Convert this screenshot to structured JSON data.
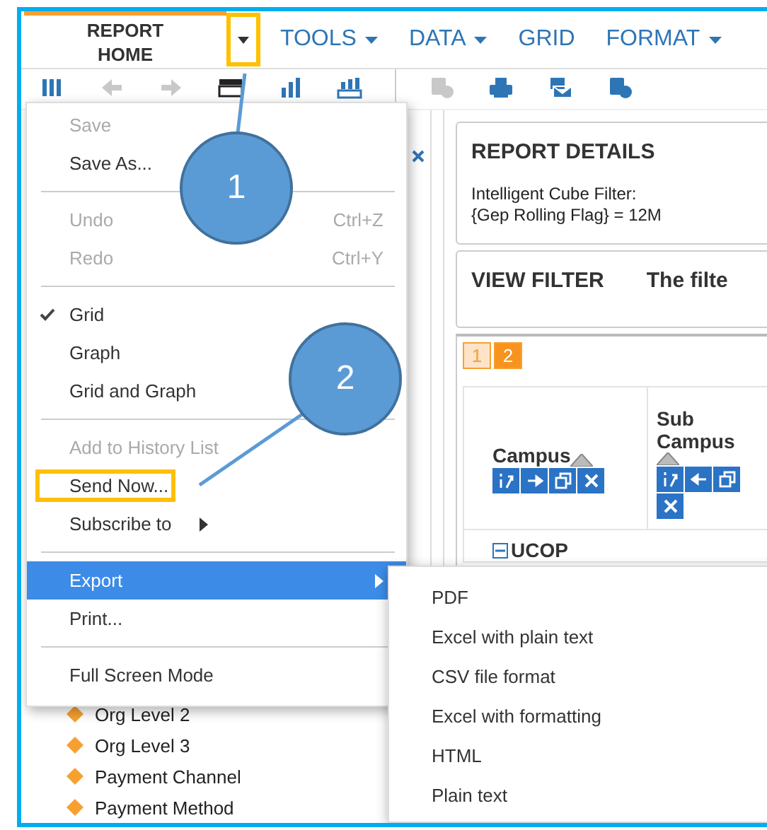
{
  "menubar": [
    {
      "label": "REPORT HOME",
      "selected": true,
      "dropdown": true,
      "outlined": true
    },
    {
      "label": "TOOLS",
      "selected": false,
      "dropdown": true,
      "outlined": false
    },
    {
      "label": "DATA",
      "selected": false,
      "dropdown": true,
      "outlined": false
    },
    {
      "label": "GRID",
      "selected": false,
      "dropdown": false,
      "outlined": false
    },
    {
      "label": "FORMAT",
      "selected": false,
      "dropdown": true,
      "outlined": false
    }
  ],
  "toolbar": [
    {
      "kind": "panel",
      "disabled": false
    },
    {
      "kind": "undo",
      "disabled": true
    },
    {
      "kind": "redo",
      "disabled": true
    },
    {
      "kind": "grid",
      "disabled": false
    },
    {
      "kind": "graph",
      "disabled": false
    },
    {
      "kind": "grid-graph",
      "disabled": false
    },
    {
      "kind": "schedule",
      "disabled": true
    },
    {
      "kind": "print",
      "disabled": false
    },
    {
      "kind": "email",
      "disabled": false
    },
    {
      "kind": "subscribe",
      "disabled": false
    }
  ],
  "menu": {
    "items": [
      {
        "kind": "item",
        "label": "Save",
        "disabled": true,
        "checked": false,
        "selected": false,
        "has_submenu": false,
        "outlined": false
      },
      {
        "kind": "item",
        "label": "Save As...",
        "disabled": false,
        "checked": false,
        "selected": false,
        "has_submenu": false,
        "outlined": false
      },
      {
        "kind": "separator"
      },
      {
        "kind": "item",
        "label": "Undo",
        "shortcut": "Ctrl+Z",
        "disabled": true,
        "checked": false,
        "selected": false,
        "has_submenu": false,
        "outlined": false
      },
      {
        "kind": "item",
        "label": "Redo",
        "shortcut": "Ctrl+Y",
        "disabled": true,
        "checked": false,
        "selected": false,
        "has_submenu": false,
        "outlined": false
      },
      {
        "kind": "separator"
      },
      {
        "kind": "item",
        "label": "Grid",
        "disabled": false,
        "checked": true,
        "selected": false,
        "has_submenu": false,
        "outlined": false
      },
      {
        "kind": "item",
        "label": "Graph",
        "disabled": false,
        "checked": false,
        "selected": false,
        "has_submenu": false,
        "outlined": false
      },
      {
        "kind": "item",
        "label": "Grid and Graph",
        "disabled": false,
        "checked": false,
        "selected": false,
        "has_submenu": false,
        "outlined": false
      },
      {
        "kind": "separator"
      },
      {
        "kind": "item",
        "label": "Add to History List",
        "disabled": true,
        "checked": false,
        "selected": false,
        "has_submenu": false,
        "outlined": false
      },
      {
        "kind": "item",
        "label": "Send Now...",
        "disabled": false,
        "checked": false,
        "selected": false,
        "has_submenu": false,
        "outlined": true
      },
      {
        "kind": "item",
        "label": "Subscribe to",
        "disabled": false,
        "checked": false,
        "selected": false,
        "has_submenu": true,
        "outlined": false
      },
      {
        "kind": "separator"
      },
      {
        "kind": "item",
        "label": "Export",
        "disabled": false,
        "checked": false,
        "selected": true,
        "has_submenu": true,
        "outlined": false
      },
      {
        "kind": "item",
        "label": "Print...",
        "disabled": false,
        "checked": false,
        "selected": false,
        "has_submenu": false,
        "outlined": false
      },
      {
        "kind": "separator"
      },
      {
        "kind": "item",
        "label": "Full Screen Mode",
        "disabled": false,
        "checked": false,
        "selected": false,
        "has_submenu": false,
        "outlined": false
      }
    ]
  },
  "submenu": {
    "items": [
      "PDF",
      "Excel with plain text",
      "CSV file format",
      "Excel with formatting",
      "HTML",
      "Plain text"
    ]
  },
  "callouts": [
    {
      "label": "1"
    },
    {
      "label": "2"
    }
  ],
  "left_panel": {
    "items": [
      "Org Level 2",
      "Org Level 3",
      "Payment Channel",
      "Payment Method"
    ]
  },
  "report_details": {
    "title": "REPORT DETAILS",
    "lines": [
      "Intelligent Cube Filter:",
      "{Gep Rolling Flag} = 12M"
    ]
  },
  "view_filter": {
    "title": "VIEW FILTER",
    "text": "The filte"
  },
  "grid": {
    "pages": [
      {
        "label": "1",
        "selected": false
      },
      {
        "label": "2",
        "selected": true
      }
    ],
    "columns": [
      {
        "label": "Campus",
        "buttons": [
          {
            "kind": "pivot"
          },
          {
            "kind": "move-right"
          },
          {
            "kind": "window"
          },
          {
            "kind": "remove"
          }
        ]
      },
      {
        "label": "Sub Campus",
        "buttons": [
          {
            "kind": "pivot"
          },
          {
            "kind": "move-left"
          },
          {
            "kind": "window"
          },
          {
            "kind": "remove"
          }
        ]
      }
    ],
    "rows": [
      {
        "label": "UCOP",
        "expanded": true
      }
    ]
  }
}
